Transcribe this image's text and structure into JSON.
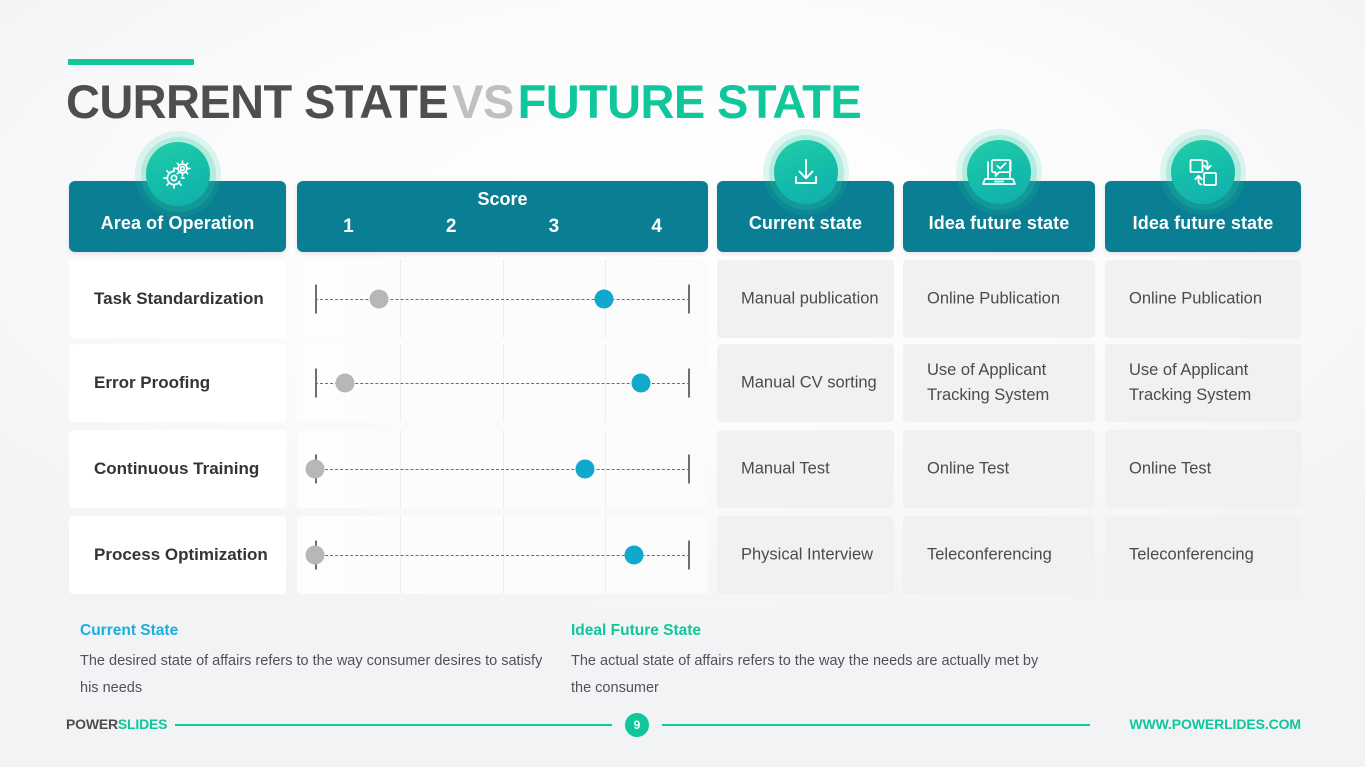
{
  "title": {
    "part1": "CURRENT STATE",
    "part2": "VS",
    "part3": "FUTURE STATE"
  },
  "colors": {
    "header_band": "#0a7e92",
    "accent_teal": "#0fc79a",
    "accent_blue": "#19aee0",
    "dot_current": "#b6b7b9",
    "dot_future": "#11a8cd",
    "title_dark": "#4e4e50",
    "title_grey": "#bfc0c2"
  },
  "header": {
    "area_of_operation": "Area of Operation",
    "score_title": "Score",
    "score_numbers": [
      "1",
      "2",
      "3",
      "4"
    ],
    "current_state": "Current state",
    "idea_future_state_1": "Idea future state",
    "idea_future_state_2": "Idea future state",
    "icons": {
      "area": "gears-icon",
      "current": "download-icon",
      "future1": "laptop-check-icon",
      "future2": "swap-squares-icon"
    }
  },
  "chart_data": {
    "type": "scatter",
    "title": "Current State vs Future State score comparison",
    "xlabel": "Score",
    "categories": [
      "Task Standardization",
      "Error Proofing",
      "Continuous Training",
      "Process Optimization"
    ],
    "tick_labels": [
      "1",
      "2",
      "3",
      "4"
    ],
    "xlim": [
      1,
      4
    ],
    "grid": true,
    "legend_position": "bottom",
    "series": [
      {
        "name": "Current State",
        "color": "#b6b7b9",
        "values": [
          1.5,
          1.25,
          1.0,
          1.0
        ]
      },
      {
        "name": "Ideal Future State",
        "color": "#11a8cd",
        "values": [
          3.3,
          3.6,
          3.15,
          3.55
        ]
      }
    ]
  },
  "rows": [
    {
      "area": "Task Standardization",
      "current_pct": 17,
      "future_pct": 77,
      "current_state": "Manual publication",
      "future_state_1": "Online Publication",
      "future_state_2": "Online Publication"
    },
    {
      "area": "Error Proofing",
      "current_pct": 8,
      "future_pct": 87,
      "current_state": "Manual CV sorting",
      "future_state_1": "Use of Applicant Tracking System",
      "future_state_2": "Use of Applicant Tracking System"
    },
    {
      "area": "Continuous Training",
      "current_pct": 0,
      "future_pct": 72,
      "current_state": "Manual Test",
      "future_state_1": "Online Test",
      "future_state_2": "Online Test"
    },
    {
      "area": "Process Optimization",
      "current_pct": 0,
      "future_pct": 85,
      "current_state": "Physical Interview",
      "future_state_1": "Teleconferencing",
      "future_state_2": "Teleconferencing"
    }
  ],
  "legend": {
    "current_title": "Current State",
    "current_body": "The desired state of affairs refers to the way consumer desires to satisfy his needs",
    "future_title": "Ideal Future  State",
    "future_body": "The actual state of affairs refers to the way the needs are actually met by the consumer"
  },
  "footer": {
    "logo_part1": "POWER",
    "logo_part2": "SLIDES",
    "page_number": "9",
    "url": "WWW.POWERLIDES.COM"
  }
}
